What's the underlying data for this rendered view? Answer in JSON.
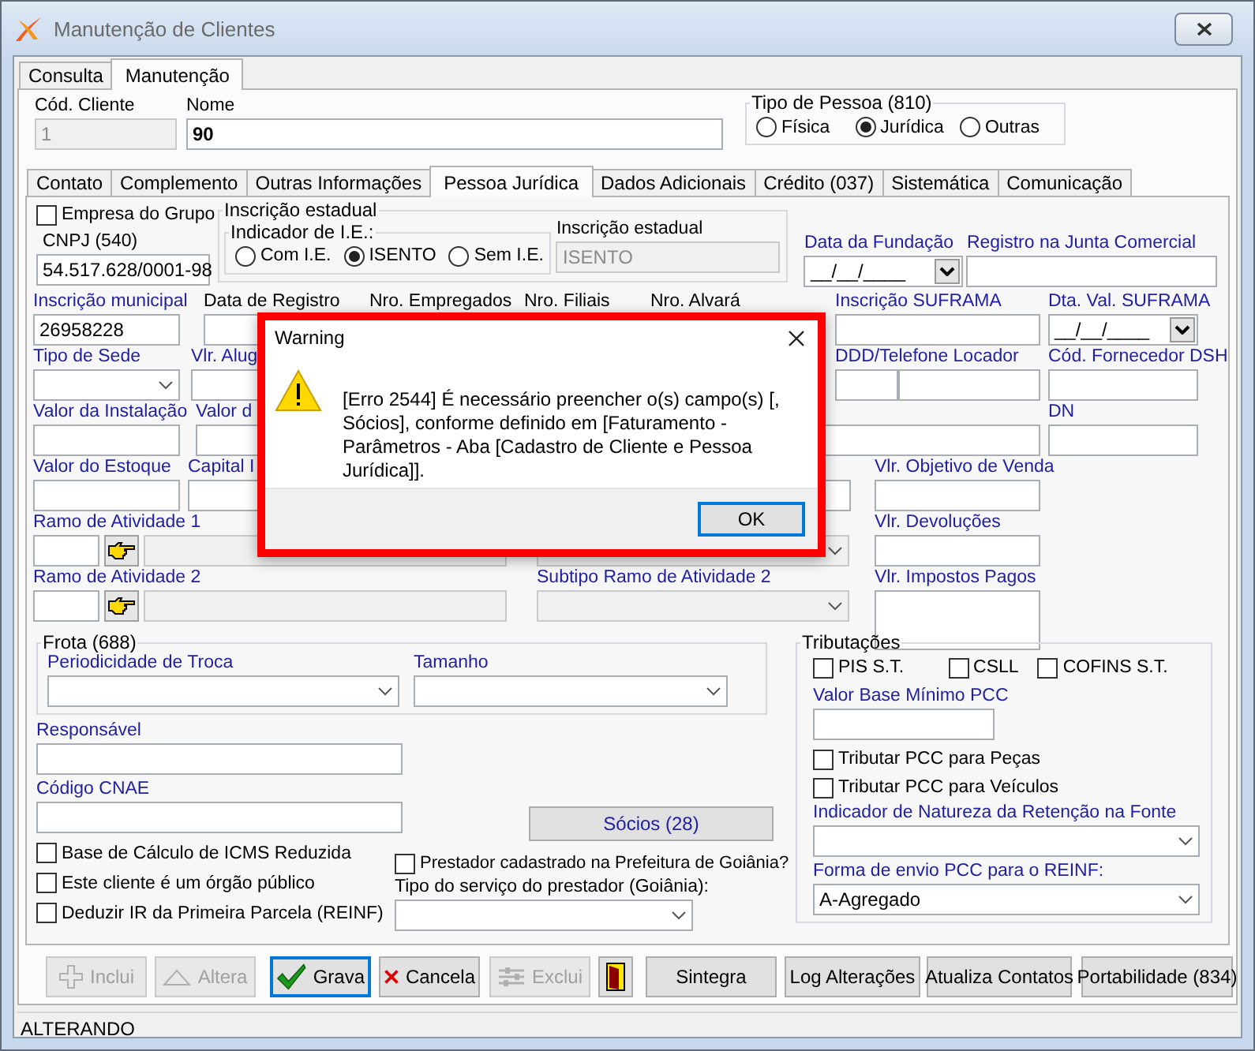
{
  "window": {
    "title": "Manutenção de Clientes"
  },
  "main_tabs": [
    {
      "label": "Consulta",
      "selected": false
    },
    {
      "label": "Manutenção",
      "selected": true
    }
  ],
  "header": {
    "cod_cliente": {
      "label": "Cód. Cliente",
      "value": "1"
    },
    "nome": {
      "label": "Nome",
      "value": "90"
    },
    "tipo_pessoa": {
      "title": "Tipo de Pessoa (810)",
      "options": [
        {
          "label": "Física",
          "selected": false
        },
        {
          "label": "Jurídica",
          "selected": true
        },
        {
          "label": "Outras",
          "selected": false
        }
      ]
    }
  },
  "tabs": [
    {
      "label": "Contato",
      "selected": false
    },
    {
      "label": "Complemento",
      "selected": false
    },
    {
      "label": "Outras Informações",
      "selected": false
    },
    {
      "label": "Pessoa Jurídica",
      "selected": true
    },
    {
      "label": "Dados Adicionais",
      "selected": false
    },
    {
      "label": "Crédito (037)",
      "selected": false
    },
    {
      "label": "Sistemática",
      "selected": false
    },
    {
      "label": "Comunicação",
      "selected": false
    }
  ],
  "pj": {
    "empresa_grupo": {
      "label": "Empresa do Grupo",
      "checked": false
    },
    "cnpj": {
      "label": "CNPJ (540)",
      "value": "54.517.628/0001-98"
    },
    "inscricao_estadual": {
      "title": "Inscrição estadual",
      "indicador": {
        "title": "Indicador de I.E.:",
        "options": [
          {
            "label": "Com I.E.",
            "selected": false
          },
          {
            "label": "ISENTO",
            "selected": true
          },
          {
            "label": "Sem I.E.",
            "selected": false
          }
        ]
      },
      "field": {
        "label": "Inscrição estadual",
        "value": "ISENTO",
        "disabled": true
      }
    },
    "data_fundacao": {
      "label": "Data da Fundação",
      "value": "__/__/____"
    },
    "registro_junta": {
      "label": "Registro na Junta Comercial"
    },
    "inscricao_municipal": {
      "label": "Inscrição municipal",
      "value": "26958228"
    },
    "data_registro": {
      "label": "Data de Registro"
    },
    "nro_empregados": {
      "label": "Nro. Empregados"
    },
    "nro_filiais": {
      "label": "Nro. Filiais"
    },
    "nro_alvara": {
      "label": "Nro. Alvará"
    },
    "inscricao_suframa": {
      "label": "Inscrição SUFRAMA"
    },
    "dta_val_suframa": {
      "label": "Dta. Val. SUFRAMA",
      "value": "__/__/____"
    },
    "tipo_sede": {
      "label": "Tipo de Sede"
    },
    "vlr_alug": {
      "label": "Vlr. Alug"
    },
    "ddd_telefone": {
      "label": "DDD/Telefone Locador"
    },
    "cod_fornecedor": {
      "label": "Cód. Fornecedor DSH"
    },
    "valor_instalacao": {
      "label": "Valor da Instalação"
    },
    "column_valor": {
      "label": "Valor d"
    },
    "dn": {
      "label": "DN"
    },
    "valor_estoque": {
      "label": "Valor do Estoque"
    },
    "capital": {
      "label": "Capital I"
    },
    "vlr_objetivo": {
      "label": "Vlr. Objetivo de Venda"
    },
    "ramo_1": {
      "label": "Ramo de Atividade 1"
    },
    "vlr_devolucoes": {
      "label": "Vlr. Devoluções"
    },
    "ramo_2": {
      "label": "Ramo de Atividade 2"
    },
    "subtipo_ramo_2": {
      "label": "Subtipo Ramo de Atividade 2"
    },
    "vlr_impostos": {
      "label": "Vlr. Impostos Pagos"
    },
    "frota": {
      "title": "Frota (688)",
      "periodicidade": {
        "label": "Periodicidade de Troca"
      },
      "tamanho": {
        "label": "Tamanho"
      }
    },
    "responsavel": {
      "label": "Responsável"
    },
    "codigo_cnae": {
      "label": "Código CNAE"
    },
    "checks": [
      {
        "label": "Base de Cálculo de ICMS Reduzida",
        "checked": false
      },
      {
        "label": "Este cliente é um órgão público",
        "checked": false
      },
      {
        "label": "Deduzir IR da Primeira Parcela (REINF)",
        "checked": false
      }
    ],
    "socios_button": "Sócios (28)",
    "prestador": {
      "label": "Prestador cadastrado na Prefeitura de Goiânia?",
      "checked": false
    },
    "tipo_servico": {
      "label": "Tipo do serviço do prestador (Goiânia):"
    },
    "tributacoes": {
      "title": "Tributações",
      "checks": [
        {
          "label": "PIS S.T.",
          "checked": false
        },
        {
          "label": "CSLL",
          "checked": false
        },
        {
          "label": "COFINS S.T.",
          "checked": false
        }
      ],
      "valor_base": {
        "label": "Valor Base Mínimo PCC"
      },
      "tributar": [
        {
          "label": "Tributar PCC para Peças",
          "checked": false
        },
        {
          "label": "Tributar PCC para Veículos",
          "checked": false
        }
      ],
      "indicador_natureza": {
        "label": "Indicador de Natureza da Retenção na Fonte"
      },
      "forma_envio": {
        "label": "Forma de envio PCC para o REINF:",
        "value": "A-Agregado"
      }
    }
  },
  "buttons": [
    {
      "kind": "add",
      "label": "Inclui",
      "disabled": true,
      "focused": false
    },
    {
      "kind": "edit",
      "label": "Altera",
      "disabled": true,
      "focused": false
    },
    {
      "kind": "save",
      "label": "Grava",
      "disabled": false,
      "focused": true
    },
    {
      "kind": "cancel",
      "label": "Cancela",
      "disabled": false,
      "focused": false
    },
    {
      "kind": "delete",
      "label": "Exclui",
      "disabled": true,
      "focused": false
    },
    {
      "kind": "exit",
      "disabled": false,
      "focused": false
    },
    {
      "kind": "plain",
      "label": "Sintegra",
      "disabled": false,
      "focused": false
    },
    {
      "kind": "plain",
      "label": "Log Alterações",
      "disabled": false,
      "focused": false
    },
    {
      "kind": "plain",
      "label": "Atualiza Contatos",
      "disabled": false,
      "focused": false
    },
    {
      "kind": "plain",
      "label": "Portabilidade (834)",
      "disabled": false,
      "focused": false
    }
  ],
  "status": "ALTERANDO",
  "dialog": {
    "title": "Warning",
    "message": "[Erro 2544] É necessário preencher o(s) campo(s) [, Sócios], conforme definido em [Faturamento - Parâmetros - Aba [Cadastro de Cliente e Pessoa Jurídica]].",
    "button": "OK"
  }
}
